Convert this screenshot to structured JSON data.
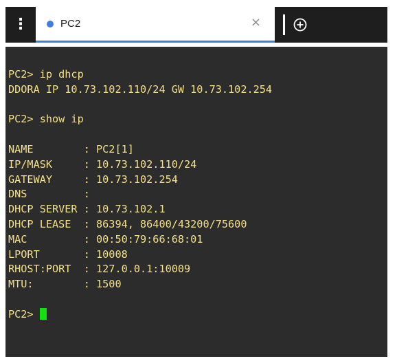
{
  "tab": {
    "title": "PC2",
    "close_glyph": "×",
    "dot_color": "#3d7ee0",
    "menu_icon": "⋮",
    "add_icon": "add-tab-icon"
  },
  "terminal": {
    "text_color": "#f4e08a",
    "background": "#2c2c2c",
    "caret_color": "#14e014",
    "lines": [
      "PC2> ip dhcp",
      "DDORA IP 10.73.102.110/24 GW 10.73.102.254",
      "",
      "PC2> show ip",
      "",
      "NAME        : PC2[1]",
      "IP/MASK     : 10.73.102.110/24",
      "GATEWAY     : 10.73.102.254",
      "DNS         :",
      "DHCP SERVER : 10.73.102.1",
      "DHCP LEASE  : 86394, 86400/43200/75600",
      "MAC         : 00:50:79:66:68:01",
      "LPORT       : 10008",
      "RHOST:PORT  : 127.0.0.1:10009",
      "MTU:        : 1500",
      ""
    ],
    "prompt": "PC2> "
  }
}
